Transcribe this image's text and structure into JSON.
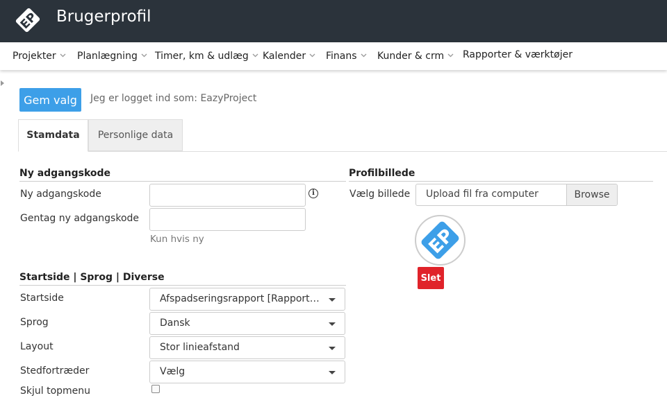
{
  "app": {
    "title": "Brugerprofil",
    "logo_icon": "ep-logo"
  },
  "nav": {
    "items": [
      {
        "label": "Projekter",
        "has_dropdown": true
      },
      {
        "label": "Planlægning",
        "has_dropdown": true
      },
      {
        "label": "Timer, km & udlæg",
        "has_dropdown": true
      },
      {
        "label": "Kalender",
        "has_dropdown": true
      },
      {
        "label": "Finans",
        "has_dropdown": true
      },
      {
        "label": "Kunder & crm",
        "has_dropdown": true
      },
      {
        "label": "Rapporter & værktøjer",
        "has_dropdown": false
      }
    ]
  },
  "toolbar": {
    "save_label": "Gem valg",
    "logged_in_text": "Jeg er logget ind som: EazyProject"
  },
  "tabs": [
    {
      "label": "Stamdata",
      "active": true
    },
    {
      "label": "Personlige data",
      "active": false
    }
  ],
  "password_section": {
    "title": "Ny adgangskode",
    "new_password_label": "Ny adgangskode",
    "new_password_value": "",
    "repeat_password_label": "Gentag ny adgangskode",
    "repeat_password_value": "",
    "hint": "Kun hvis ny",
    "info_icon": "info-icon"
  },
  "startpage_section": {
    "title": "Startside | Sprog | Diverse",
    "startside_label": "Startside",
    "startside_value": "Afspadseringsrapport [Rapporter & værktøjer]",
    "sprog_label": "Sprog",
    "sprog_value": "Dansk",
    "layout_label": "Layout",
    "layout_value": "Stor linieafstand",
    "stedfortraeder_label": "Stedfortræder",
    "stedfortraeder_value": "Vælg",
    "skjul_label": "Skjul topmenu",
    "skjul_checked": false
  },
  "profile_section": {
    "title": "Profilbillede",
    "choose_label": "Vælg billede",
    "upload_text": "Upload fil fra computer",
    "browse_label": "Browse",
    "delete_label": "Slet"
  },
  "colors": {
    "topbar": "#2b333b",
    "primary_button": "#3d9fe8",
    "danger_button": "#e0232a",
    "logo_blue": "#3d9fe8"
  }
}
